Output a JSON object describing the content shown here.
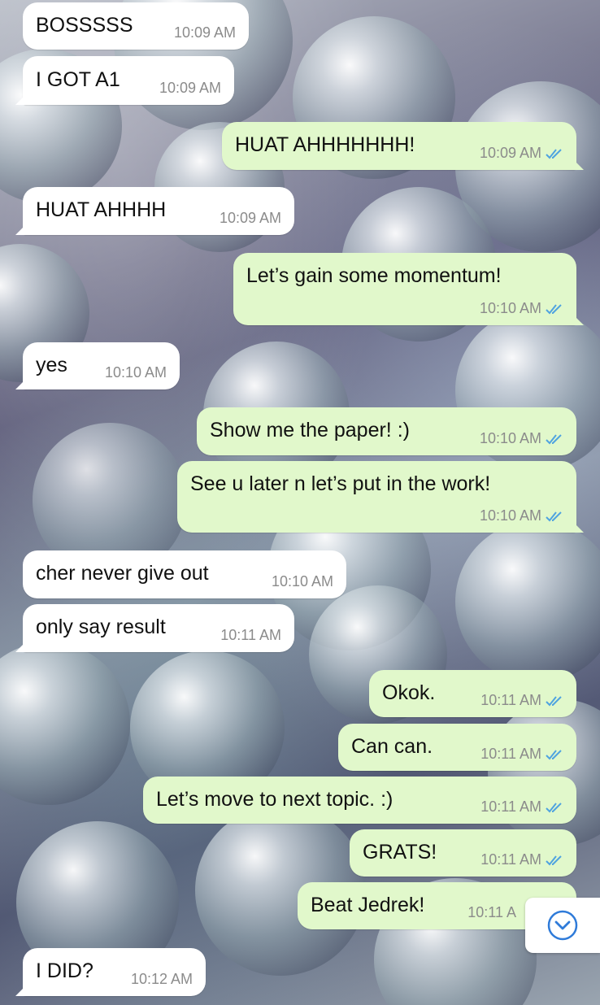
{
  "chat": {
    "messages": [
      {
        "direction": "in",
        "text": "BOSSSSS",
        "time": "10:09 AM"
      },
      {
        "direction": "in",
        "text": "I GOT A1",
        "time": "10:09 AM"
      },
      {
        "direction": "out",
        "text": "HUAT AHHHHHHH!",
        "time": "10:09 AM",
        "status": "read"
      },
      {
        "direction": "in",
        "text": "HUAT AHHHH",
        "time": "10:09 AM"
      },
      {
        "direction": "out",
        "text": "Let’s gain some momentum!",
        "time": "10:10 AM",
        "status": "read"
      },
      {
        "direction": "in",
        "text": "yes",
        "time": "10:10 AM"
      },
      {
        "direction": "out",
        "text": "Show me the paper! :)",
        "time": "10:10 AM",
        "status": "read"
      },
      {
        "direction": "out",
        "text": "See u later n let’s put in the work!",
        "time": "10:10 AM",
        "status": "read"
      },
      {
        "direction": "in",
        "text": "cher never give out",
        "time": "10:10 AM"
      },
      {
        "direction": "in",
        "text": "only say result",
        "time": "10:11 AM"
      },
      {
        "direction": "out",
        "text": "Okok.",
        "time": "10:11 AM",
        "status": "read"
      },
      {
        "direction": "out",
        "text": "Can can.",
        "time": "10:11 AM",
        "status": "read"
      },
      {
        "direction": "out",
        "text": "Let’s move to next topic. :)",
        "time": "10:11 AM",
        "status": "read"
      },
      {
        "direction": "out",
        "text": "GRATS!",
        "time": "10:11 AM",
        "status": "read"
      },
      {
        "direction": "out",
        "text": "Beat Jedrek!",
        "time": "10:11 A",
        "status": "read"
      },
      {
        "direction": "in",
        "text": "I DID?",
        "time": "10:12 AM"
      }
    ]
  },
  "colors": {
    "incoming_bubble": "#ffffff",
    "outgoing_bubble": "#e1f8cb",
    "read_tick": "#4fa3e0",
    "scroll_button_icon": "#2f7bd9"
  },
  "icons": {
    "read_receipt": "double-check-icon",
    "scroll_down": "chevron-down-circle-icon"
  }
}
